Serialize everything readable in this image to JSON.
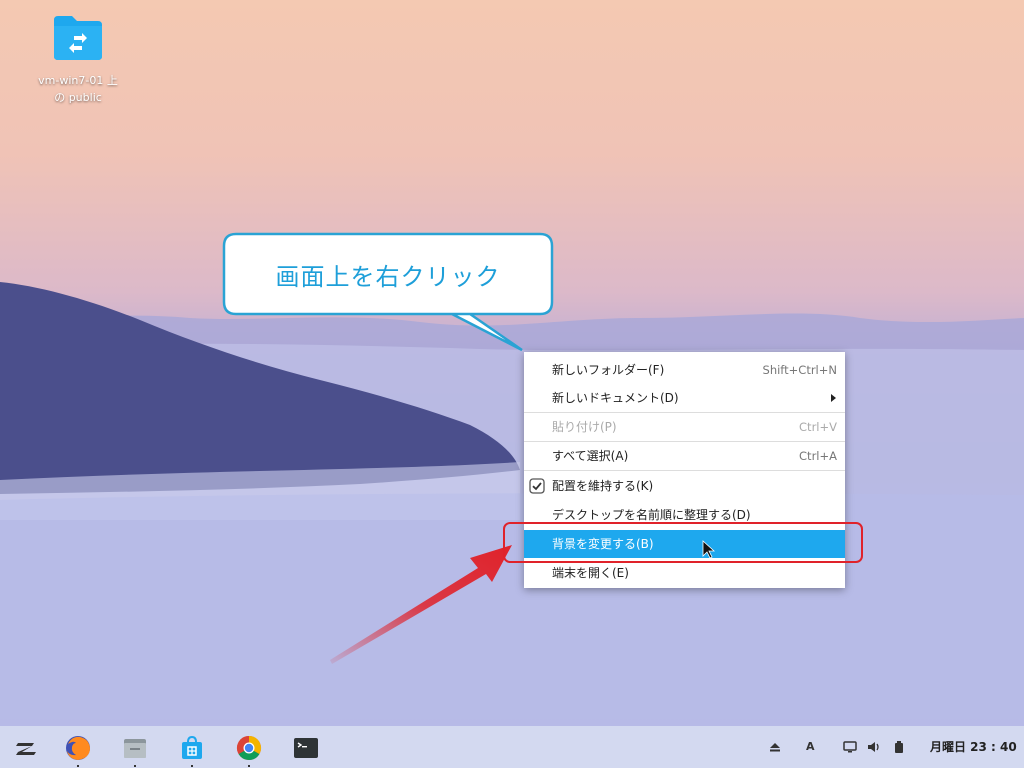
{
  "desktop": {
    "icons": [
      {
        "label_line1": "vm-win7-01 上",
        "label_line2": "の public"
      }
    ]
  },
  "callout": {
    "text": "画面上を右クリック"
  },
  "context_menu": {
    "items": [
      {
        "label": "新しいフォルダー(F)",
        "shortcut": "Shift+Ctrl+N"
      },
      {
        "label": "新しいドキュメント(D)",
        "shortcut": ""
      },
      {
        "label": "貼り付け(P)",
        "shortcut": "Ctrl+V"
      },
      {
        "label": "すべて選択(A)",
        "shortcut": "Ctrl+A"
      },
      {
        "label": "配置を維持する(K)",
        "shortcut": ""
      },
      {
        "label": "デスクトップを名前順に整理する(D)",
        "shortcut": ""
      },
      {
        "label": "背景を変更する(B)",
        "shortcut": ""
      },
      {
        "label": "端末を開く(E)",
        "shortcut": ""
      }
    ],
    "highlight_color": "#1ea8ee"
  },
  "taskbar": {
    "apps": [
      "zorin-menu-icon",
      "firefox-icon",
      "files-icon",
      "software-store-icon",
      "chrome-icon",
      "terminal-icon"
    ],
    "tray": {
      "keyboard_indicator": "A"
    },
    "clock": "月曜日 23 : 40"
  },
  "colors": {
    "accent": "#1ea8ee",
    "annotation": "#e0222a",
    "callout_text": "#1e9fd9"
  }
}
